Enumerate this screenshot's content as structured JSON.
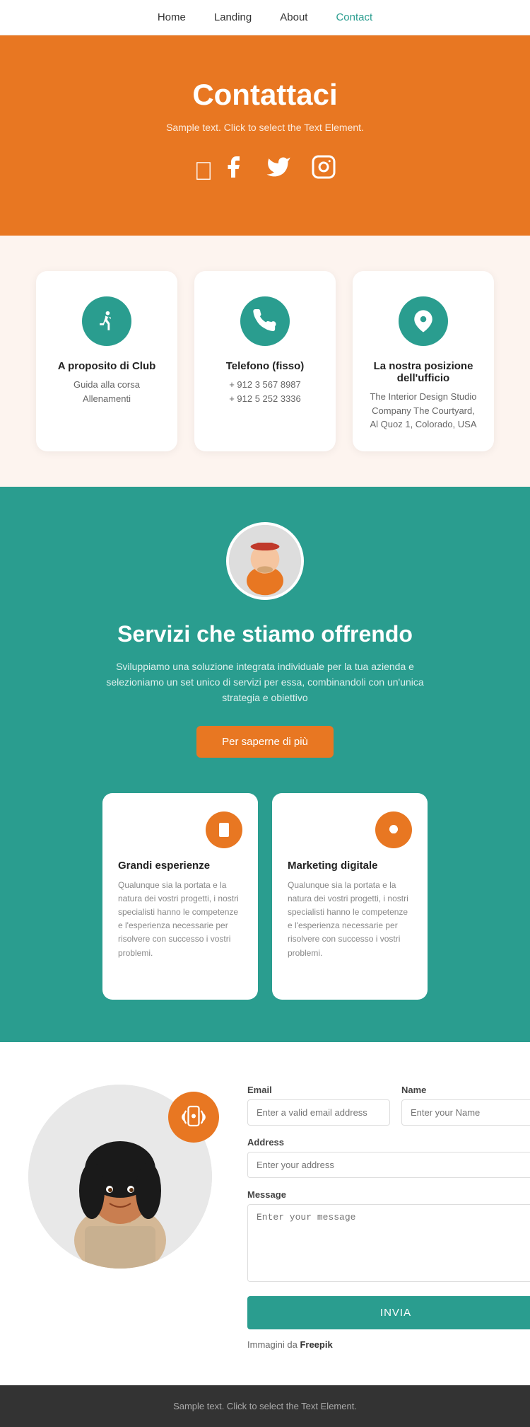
{
  "nav": {
    "items": [
      {
        "label": "Home",
        "active": false
      },
      {
        "label": "Landing",
        "active": false
      },
      {
        "label": "About",
        "active": false
      },
      {
        "label": "Contact",
        "active": true
      }
    ]
  },
  "hero": {
    "title": "Contattaci",
    "subtitle": "Sample text. Click to select the Text Element.",
    "icons": [
      "facebook",
      "twitter",
      "instagram"
    ]
  },
  "cards": [
    {
      "icon": "run",
      "title": "A proposito di Club",
      "lines": [
        "Guida alla corsa",
        "Allenamenti"
      ]
    },
    {
      "icon": "phone",
      "title": "Telefono (fisso)",
      "lines": [
        "+ 912 3 567 8987",
        "+ 912 5 252 3336"
      ]
    },
    {
      "icon": "location",
      "title": "La nostra posizione dell'ufficio",
      "lines": [
        "The Interior Design Studio Company The Courtyard, Al Quoz 1, Colorado, USA"
      ]
    }
  ],
  "teal_section": {
    "heading": "Servizi che stiamo offrendo",
    "description": "Sviluppiamo una soluzione integrata individuale per la tua azienda e selezioniamo un set unico di servizi per essa, combinandoli con un'unica strategia e obiettivo",
    "button_label": "Per saperne di più",
    "services": [
      {
        "icon": "mobile",
        "title": "Grandi esperienze",
        "description": "Qualunque sia la portata e la natura dei vostri progetti, i nostri specialisti hanno le competenze e l'esperienza necessarie per risolvere con successo i vostri problemi."
      },
      {
        "icon": "lightbulb",
        "title": "Marketing digitale",
        "description": "Qualunque sia la portata e la natura dei vostri progetti, i nostri specialisti hanno le competenze e l'esperienza necessarie per risolvere con successo i vostri problemi."
      }
    ]
  },
  "contact_form": {
    "email_label": "Email",
    "email_placeholder": "Enter a valid email address",
    "name_label": "Name",
    "name_placeholder": "Enter your Name",
    "address_label": "Address",
    "address_placeholder": "Enter your address",
    "message_label": "Message",
    "message_placeholder": "Enter your message",
    "submit_label": "INVIA",
    "attribution": "Immagini da",
    "attribution_link": "Freepik"
  },
  "footer": {
    "text": "Sample text. Click to select the Text Element."
  }
}
